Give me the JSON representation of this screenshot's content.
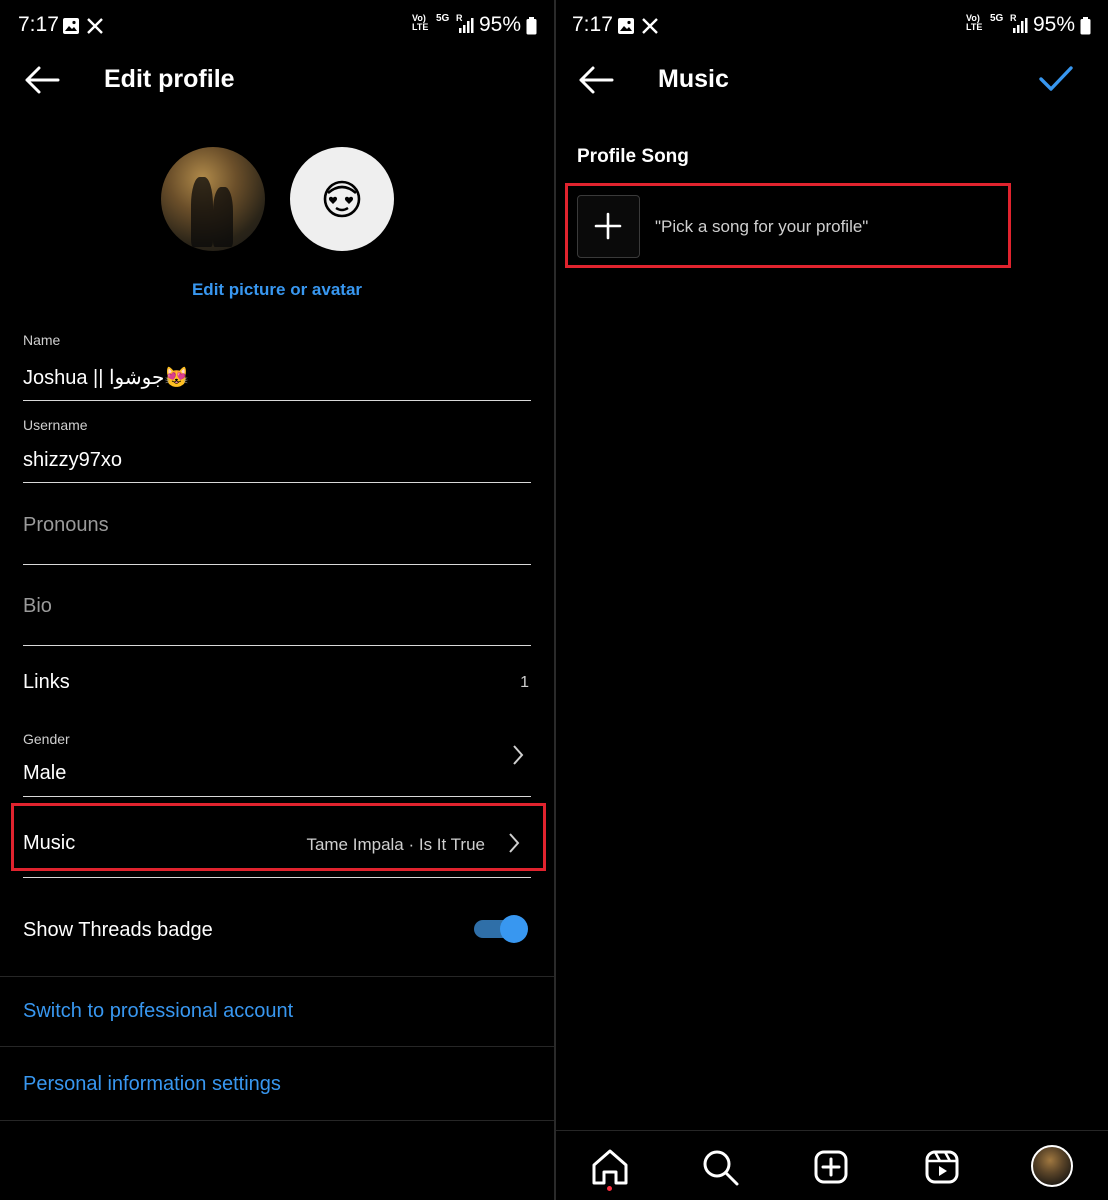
{
  "status_bar": {
    "time": "7:17",
    "battery": "95%",
    "net_top": "Vo)",
    "net_bottom": "LTE",
    "net_5g": "5G",
    "signal_r": "R"
  },
  "edit_profile": {
    "title": "Edit profile",
    "edit_picture_label": "Edit picture or avatar",
    "name": {
      "label": "Name",
      "value": "Joshua || جوشوا😻"
    },
    "username": {
      "label": "Username",
      "value": "shizzy97xo"
    },
    "pronouns": {
      "placeholder": "Pronouns"
    },
    "bio": {
      "placeholder": "Bio"
    },
    "links": {
      "label": "Links",
      "count": "1"
    },
    "gender": {
      "label": "Gender",
      "value": "Male"
    },
    "music": {
      "label": "Music",
      "value": "Tame Impala · Is It True"
    },
    "threads_badge": {
      "label": "Show Threads badge",
      "enabled": true
    },
    "switch_professional": "Switch to professional account",
    "personal_info": "Personal information settings"
  },
  "music_page": {
    "title": "Music",
    "section_title": "Profile Song",
    "pick_song": "\"Pick a song for your profile\""
  },
  "bottom_nav": {
    "items": [
      "home-icon",
      "search-icon",
      "create-icon",
      "reels-icon",
      "profile-avatar"
    ]
  },
  "colors": {
    "accent": "#3897f0",
    "highlight": "#e0232e",
    "background": "#000000"
  }
}
